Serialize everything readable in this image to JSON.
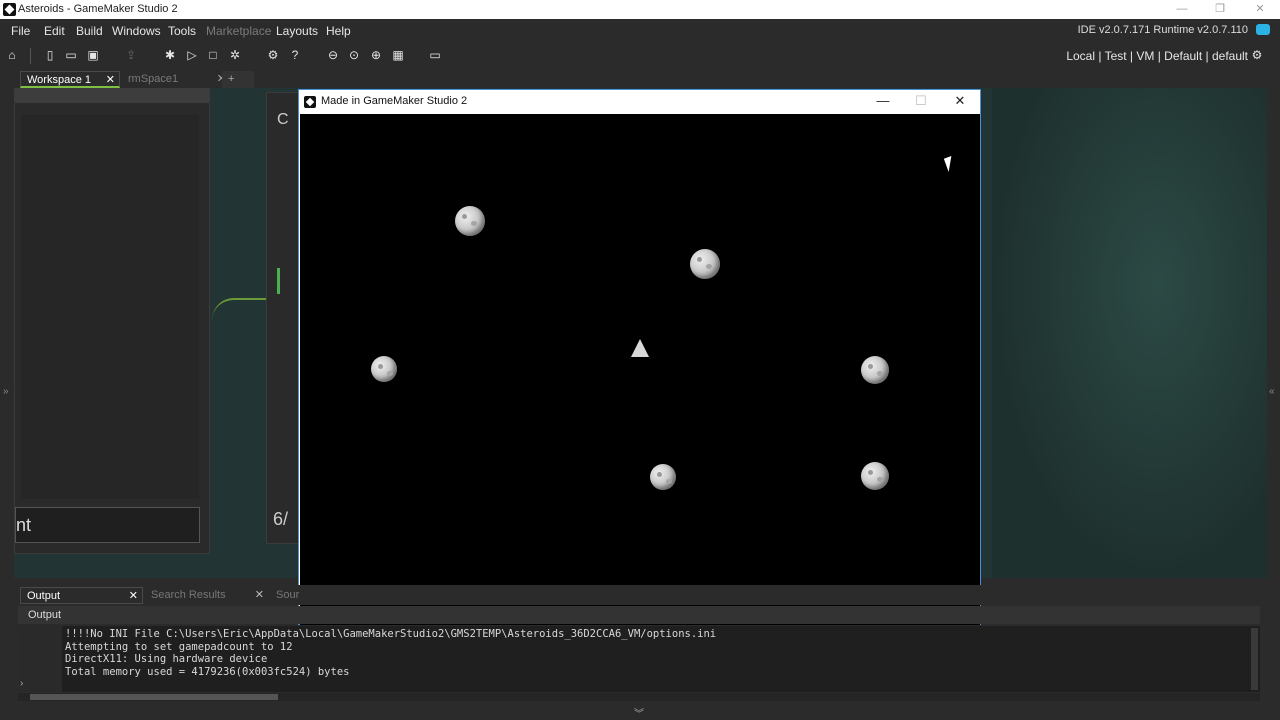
{
  "window": {
    "title": "Asteroids - GameMaker Studio 2",
    "minimize": "—",
    "restore": "❐",
    "close": "✕"
  },
  "menu": {
    "items": [
      "File",
      "Edit",
      "Build",
      "Windows",
      "Tools",
      "Marketplace",
      "Layouts",
      "Help"
    ],
    "ide_version": "IDE v2.0.7.171 Runtime v2.0.7.110"
  },
  "toolbar": {
    "targets": "Local | Test | VM | Default | default"
  },
  "tabs": {
    "workspace": "Workspace 1",
    "room": "rmSpace1",
    "add": "+",
    "close": "✕"
  },
  "workspace": {
    "field_fragment": "nt",
    "panel2_fragment": "6/",
    "panel2_top_fragment": "C"
  },
  "game_window": {
    "title": "Made in GameMaker Studio 2",
    "minimize": "—",
    "maximize": "☐",
    "close": "✕"
  },
  "output": {
    "tabs": [
      "Output",
      "Search Results",
      "Sour"
    ],
    "header": "Output",
    "lines": [
      "!!!!No INI File C:\\Users\\Eric\\AppData\\Local\\GameMakerStudio2\\GMS2TEMP\\Asteroids_36D2CCA6_VM/options.ini",
      "Attempting to set gamepadcount to 12",
      "DirectX11: Using hardware device",
      "Total memory used = 4179236(0x003fc524) bytes"
    ],
    "prompt": "›"
  }
}
